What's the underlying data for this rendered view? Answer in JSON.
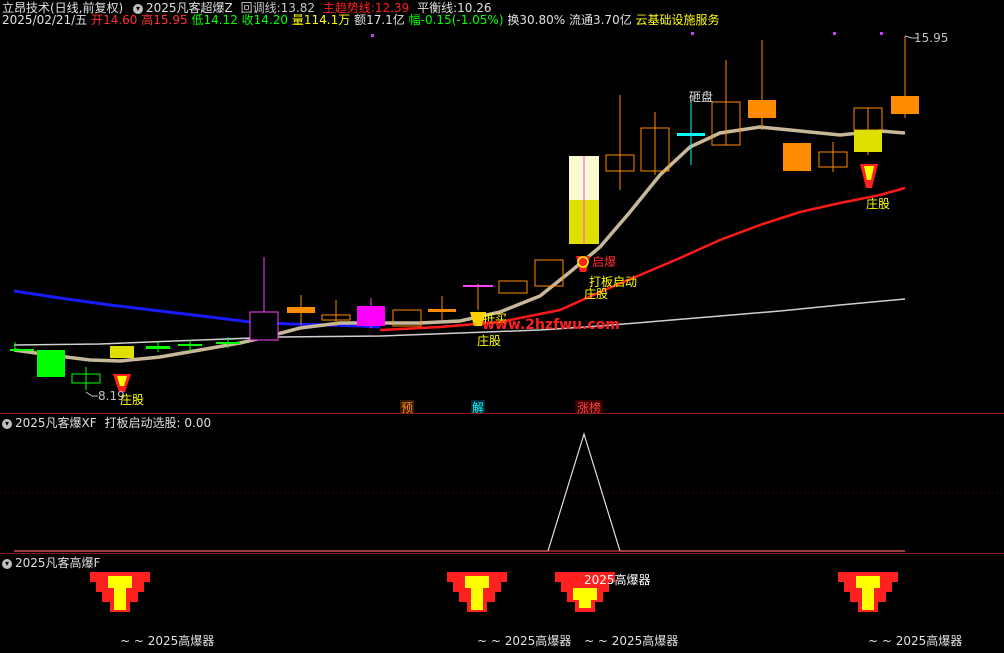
{
  "header1": {
    "indicator_name": "立昂技术(日线,前复权)",
    "formula_name": "2025凡客超爆Z",
    "huitiao_label": "回调线:",
    "huitiao_value": "13.82",
    "zhuqushi_label": "主趋势线:",
    "zhuqushi_value": "12.39",
    "pingheng_label": "平衡线:",
    "pingheng_value": "10.26"
  },
  "header2": {
    "date": "2025/02/21/五",
    "open_label": "开",
    "open": "14.60",
    "high_label": "高",
    "high": "15.95",
    "low_label": "低",
    "low": "14.12",
    "close_label": "收",
    "close": "14.20",
    "vol_label": "量",
    "vol": "114.1万",
    "amt_label": "额",
    "amt": "17.1亿",
    "chg_label": "幅",
    "chg": "-0.15(-1.05%)",
    "turn_label": "换",
    "turn": "30.80%",
    "float_label": "流通",
    "float": "3.70亿",
    "sector": "云基础设施服务"
  },
  "chart_labels": {
    "high_price": "15.95",
    "low_price": "8.19",
    "zaopan": "砸盘",
    "qibao": "启爆",
    "daban": "打板启动",
    "zhuanggu": "庄股",
    "dimai": "抵买",
    "watermark": "www.2hzfwu.com",
    "tag_yu": "预",
    "tag_jie": "解",
    "tag_zhangbang": "涨榜"
  },
  "pane2": {
    "name": "2025凡客爆XF",
    "label": "打板启动选股:",
    "value": "0.00"
  },
  "pane3": {
    "name": "2025凡客高爆F",
    "tag": "2025高爆器",
    "tag_prefixed": "~ ~ 2025高爆器"
  },
  "colors": {
    "background": "#000000",
    "up": "#ff3232",
    "down": "#00ffff",
    "ma_tan": "#c8b89a",
    "ma_red": "#ff1a1a",
    "ma_white": "#d0d0d0",
    "ma_blue": "#1a1aff",
    "yellow": "#ffff00",
    "magenta": "#ff00ff",
    "green": "#00ff00",
    "orange": "#ff8c00"
  }
}
